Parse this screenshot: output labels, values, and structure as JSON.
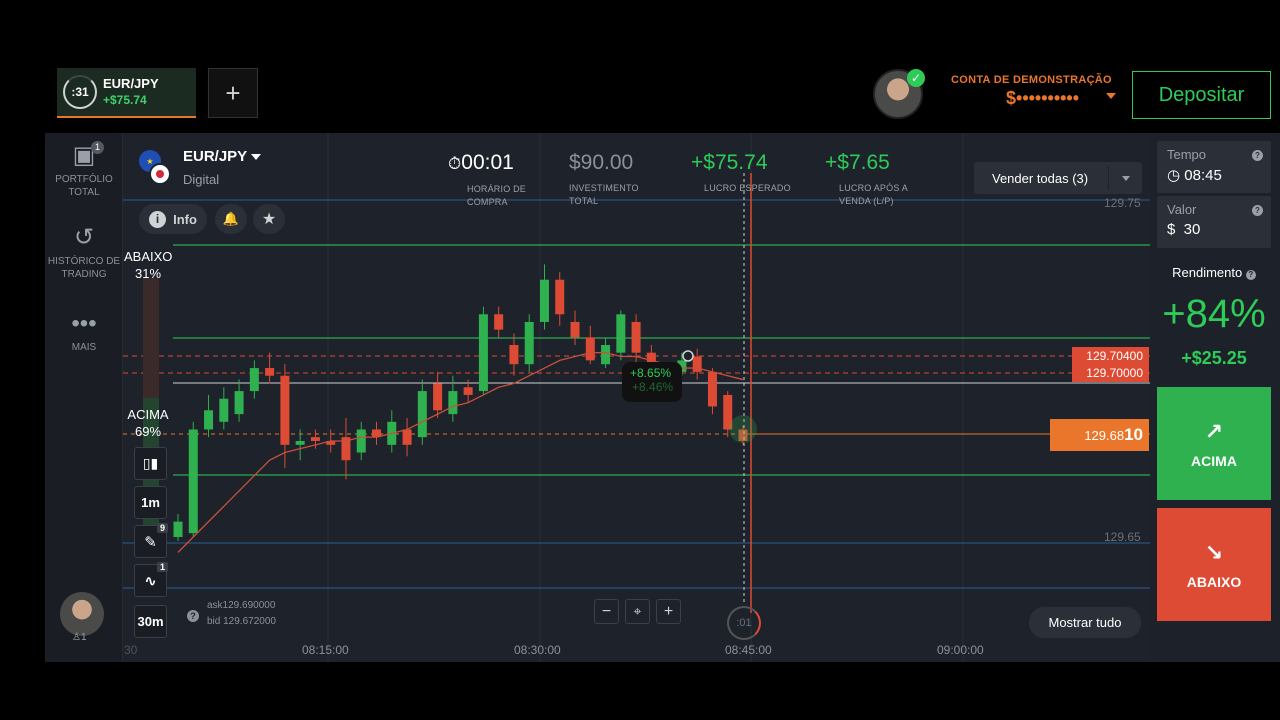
{
  "active_tab": {
    "timer": ":31",
    "asset": "EUR/JPY",
    "profit": "+$75.74"
  },
  "add_tab": {
    "icon": "plus-icon",
    "label": "+"
  },
  "account": {
    "type_label": "CONTA DE DEMONSTRAÇÃO",
    "balance_masked": "$••••••••••",
    "deposit_label": "Depositar"
  },
  "left_nav": {
    "items": [
      {
        "label": "PORTFÓLIO TOTAL",
        "icon": "briefcase-icon",
        "badge": "1"
      },
      {
        "label": "HISTÓRICO DE TRADING",
        "icon": "history-icon"
      },
      {
        "label": "MAIS",
        "icon": "more-icon"
      }
    ],
    "avatar_count": "1"
  },
  "asset_header": {
    "pair": "EUR/JPY",
    "type": "Digital",
    "info_label": "Info"
  },
  "stats": {
    "purchase_time": {
      "value": "00:01",
      "label": "HORÁRIO DE COMPRA"
    },
    "investment": {
      "value": "$90.00",
      "label": "INVESTIMENTO TOTAL"
    },
    "expected_profit": {
      "value": "+$75.74",
      "label": "LUCRO ESPERADO"
    },
    "profit_after_sale": {
      "value": "+$7.65",
      "label": "LUCRO APÓS A VENDA (L/P)"
    }
  },
  "sell_all_label": "Vender todas (3)",
  "sentiment": {
    "down_label": "ABAIXO",
    "down_pct": "31%",
    "up_label": "ACIMA",
    "up_pct": "69%"
  },
  "toolbar": {
    "timeframe": "1m",
    "period": "30m",
    "draw_badge": "9",
    "indicator_badge": "1"
  },
  "price_levels": {
    "top": "129.75",
    "bottom": "129.65",
    "order_a": "129.70400",
    "order_b": "129.70000",
    "current_main": "129.68",
    "current_tail": "10"
  },
  "trade_bubble": {
    "front": "+8.65%",
    "back": "+8.46%"
  },
  "expiry_timer": ":01",
  "quote": {
    "ask": "ask129.690000",
    "bid": "bid 129.672000"
  },
  "time_axis": [
    "08:15:00",
    "08:30:00",
    "08:45:00",
    "09:00:00"
  ],
  "time_axis_partial": "30",
  "show_all_label": "Mostrar tudo",
  "right_panel": {
    "time_label": "Tempo",
    "time_value": "08:45",
    "amount_label": "Valor",
    "amount_value": "$  30",
    "yield_label": "Rendimento",
    "yield_value": "+84%",
    "yield_amount": "+$25.25",
    "up_label": "ACIMA",
    "down_label": "ABAIXO"
  },
  "colors": {
    "up": "#2eb14e",
    "down": "#de4b34",
    "accent": "#e9762b",
    "background": "#1e222b"
  },
  "chart_data": {
    "type": "candlestick",
    "price_range": [
      129.635,
      129.76
    ],
    "candles": [
      {
        "o": 129.66,
        "c": 129.664,
        "h": 129.666,
        "l": 129.659
      },
      {
        "o": 129.661,
        "c": 129.688,
        "h": 129.69,
        "l": 129.66
      },
      {
        "o": 129.688,
        "c": 129.693,
        "h": 129.697,
        "l": 129.686
      },
      {
        "o": 129.69,
        "c": 129.696,
        "h": 129.699,
        "l": 129.688
      },
      {
        "o": 129.692,
        "c": 129.698,
        "h": 129.701,
        "l": 129.69
      },
      {
        "o": 129.698,
        "c": 129.704,
        "h": 129.706,
        "l": 129.696
      },
      {
        "o": 129.704,
        "c": 129.702,
        "h": 129.708,
        "l": 129.7
      },
      {
        "o": 129.702,
        "c": 129.684,
        "h": 129.705,
        "l": 129.678
      },
      {
        "o": 129.684,
        "c": 129.685,
        "h": 129.688,
        "l": 129.68
      },
      {
        "o": 129.686,
        "c": 129.685,
        "h": 129.688,
        "l": 129.683
      },
      {
        "o": 129.685,
        "c": 129.684,
        "h": 129.688,
        "l": 129.682
      },
      {
        "o": 129.686,
        "c": 129.68,
        "h": 129.691,
        "l": 129.675
      },
      {
        "o": 129.682,
        "c": 129.688,
        "h": 129.69,
        "l": 129.68
      },
      {
        "o": 129.688,
        "c": 129.686,
        "h": 129.69,
        "l": 129.684
      },
      {
        "o": 129.684,
        "c": 129.69,
        "h": 129.693,
        "l": 129.682
      },
      {
        "o": 129.688,
        "c": 129.684,
        "h": 129.691,
        "l": 129.681
      },
      {
        "o": 129.686,
        "c": 129.698,
        "h": 129.701,
        "l": 129.684
      },
      {
        "o": 129.7,
        "c": 129.693,
        "h": 129.703,
        "l": 129.691
      },
      {
        "o": 129.692,
        "c": 129.698,
        "h": 129.702,
        "l": 129.69
      },
      {
        "o": 129.699,
        "c": 129.697,
        "h": 129.701,
        "l": 129.695
      },
      {
        "o": 129.698,
        "c": 129.718,
        "h": 129.72,
        "l": 129.697
      },
      {
        "o": 129.718,
        "c": 129.714,
        "h": 129.72,
        "l": 129.712
      },
      {
        "o": 129.71,
        "c": 129.705,
        "h": 129.713,
        "l": 129.702
      },
      {
        "o": 129.705,
        "c": 129.716,
        "h": 129.718,
        "l": 129.703
      },
      {
        "o": 129.716,
        "c": 129.727,
        "h": 129.731,
        "l": 129.714
      },
      {
        "o": 129.727,
        "c": 129.718,
        "h": 129.729,
        "l": 129.715
      },
      {
        "o": 129.716,
        "c": 129.712,
        "h": 129.719,
        "l": 129.71
      },
      {
        "o": 129.712,
        "c": 129.706,
        "h": 129.715,
        "l": 129.705
      },
      {
        "o": 129.705,
        "c": 129.71,
        "h": 129.712,
        "l": 129.704
      },
      {
        "o": 129.708,
        "c": 129.718,
        "h": 129.719,
        "l": 129.706
      },
      {
        "o": 129.716,
        "c": 129.708,
        "h": 129.718,
        "l": 129.705
      },
      {
        "o": 129.708,
        "c": 129.704,
        "h": 129.71,
        "l": 129.702
      },
      {
        "o": 129.703,
        "c": 129.701,
        "h": 129.705,
        "l": 129.699
      },
      {
        "o": 129.703,
        "c": 129.706,
        "h": 129.708,
        "l": 129.702
      },
      {
        "o": 129.707,
        "c": 129.703,
        "h": 129.709,
        "l": 129.701
      },
      {
        "o": 129.703,
        "c": 129.694,
        "h": 129.704,
        "l": 129.692
      },
      {
        "o": 129.697,
        "c": 129.688,
        "h": 129.698,
        "l": 129.686
      },
      {
        "o": 129.688,
        "c": 129.685,
        "h": 129.689,
        "l": 129.684
      }
    ],
    "moving_average": [
      129.656,
      129.66,
      129.664,
      129.668,
      129.672,
      129.676,
      129.68,
      129.682,
      129.683,
      129.684,
      129.685,
      129.685,
      129.686,
      129.686,
      129.687,
      129.688,
      129.69,
      129.692,
      129.694,
      129.695,
      129.697,
      129.699,
      129.7,
      129.702,
      129.704,
      129.706,
      129.707,
      129.708,
      129.708,
      129.707,
      129.707,
      129.706,
      129.705,
      129.704,
      129.704,
      129.703,
      129.702,
      129.701
    ],
    "y_ticks": [
      129.75,
      129.65
    ],
    "x_ticks": [
      "08:15:00",
      "08:30:00",
      "08:45:00",
      "09:00:00"
    ]
  }
}
